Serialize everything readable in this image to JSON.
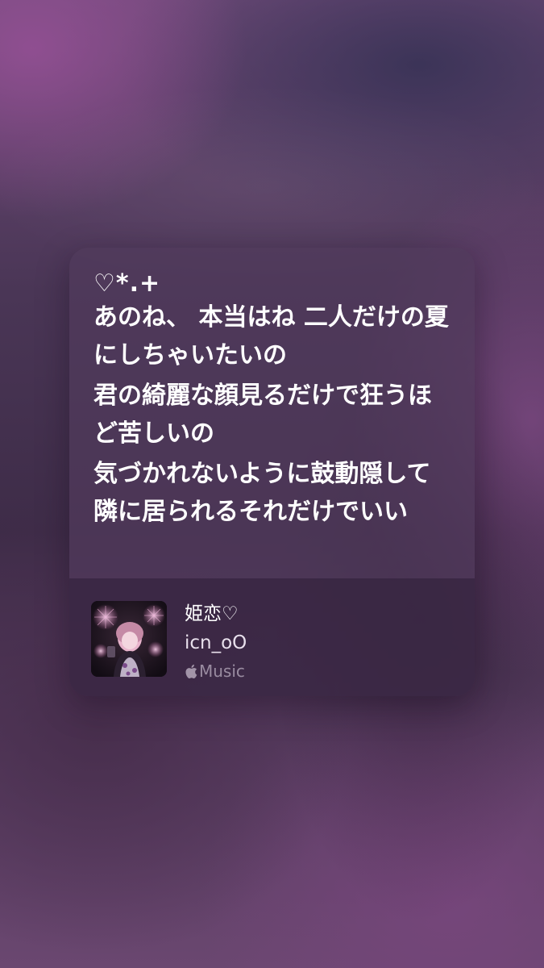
{
  "lyrics": {
    "decoration": "♡*.+",
    "blocks": [
      "あのね、 本当はね 二人だけの夏にしちゃいたいの",
      "君の綺麗な顔見るだけで狂うほど苦しいの",
      "気づかれないように鼓動隠して 隣に居られるそれだけでいい"
    ]
  },
  "track": {
    "title": "姫恋♡",
    "artist": "icn_oO",
    "service_label": "Music",
    "service_icon": "apple-logo-icon",
    "artwork_icon": "album-artwork"
  },
  "colors": {
    "text_primary": "#ffffff",
    "text_secondary": "#e8e0ec",
    "card_background": "#503a5c",
    "footer_background": "#2d1e37"
  }
}
